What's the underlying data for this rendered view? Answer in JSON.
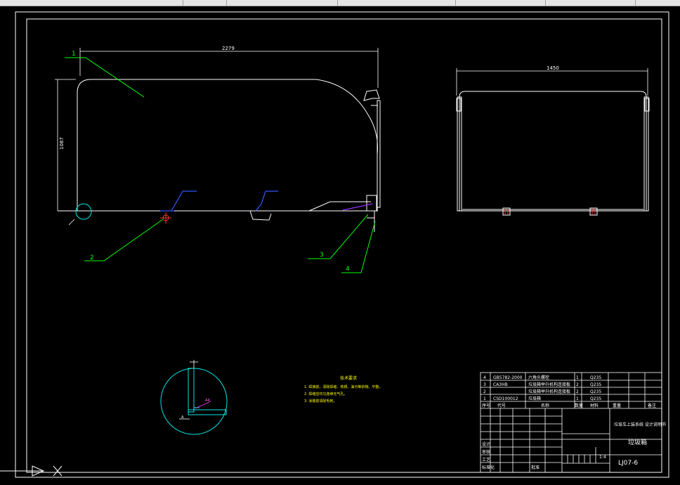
{
  "drawing": {
    "dim_length_main": "2279",
    "dim_height_main": "1087",
    "dim_width_side": "1450",
    "leaders": [
      "1",
      "2",
      "3",
      "4"
    ],
    "detail_dim": "A4",
    "detail_mark": "A",
    "notes_title": "技术要求",
    "notes": [
      "1. 焊接前，清除焊缝、铁锈、油污等杂物。平整。",
      "2. 焊缝应均匀连续无气孔。",
      "3. 涂装前清除毛刺。"
    ]
  },
  "title_block": {
    "rows": [
      {
        "no": "4",
        "code": "GB5782-2000",
        "name": "六角头螺栓",
        "qty": "1",
        "mat": "Q235"
      },
      {
        "no": "3",
        "code": "CA3HB",
        "name": "垃圾箱举升机构连接板",
        "qty": "2",
        "mat": "Q235"
      },
      {
        "no": "2",
        "code": "",
        "name": "垃圾箱举升机构连接板",
        "qty": "2",
        "mat": "Q235"
      },
      {
        "no": "1",
        "code": "CSD100012",
        "name": "垃圾箱",
        "qty": "1",
        "mat": "Q235"
      }
    ],
    "header": {
      "no": "序号",
      "code": "代号",
      "name": "名称",
      "qty": "数量",
      "mat": "材料",
      "weight": "重量",
      "remark": "备注"
    },
    "company": "垃圾车上装系统 设计说明书",
    "part_name": "垃圾箱",
    "scale": "1:4",
    "drawing_no": "LJ07-6",
    "sign_labels": [
      "设计",
      "审核",
      "工艺",
      "标准化",
      "批准"
    ]
  }
}
